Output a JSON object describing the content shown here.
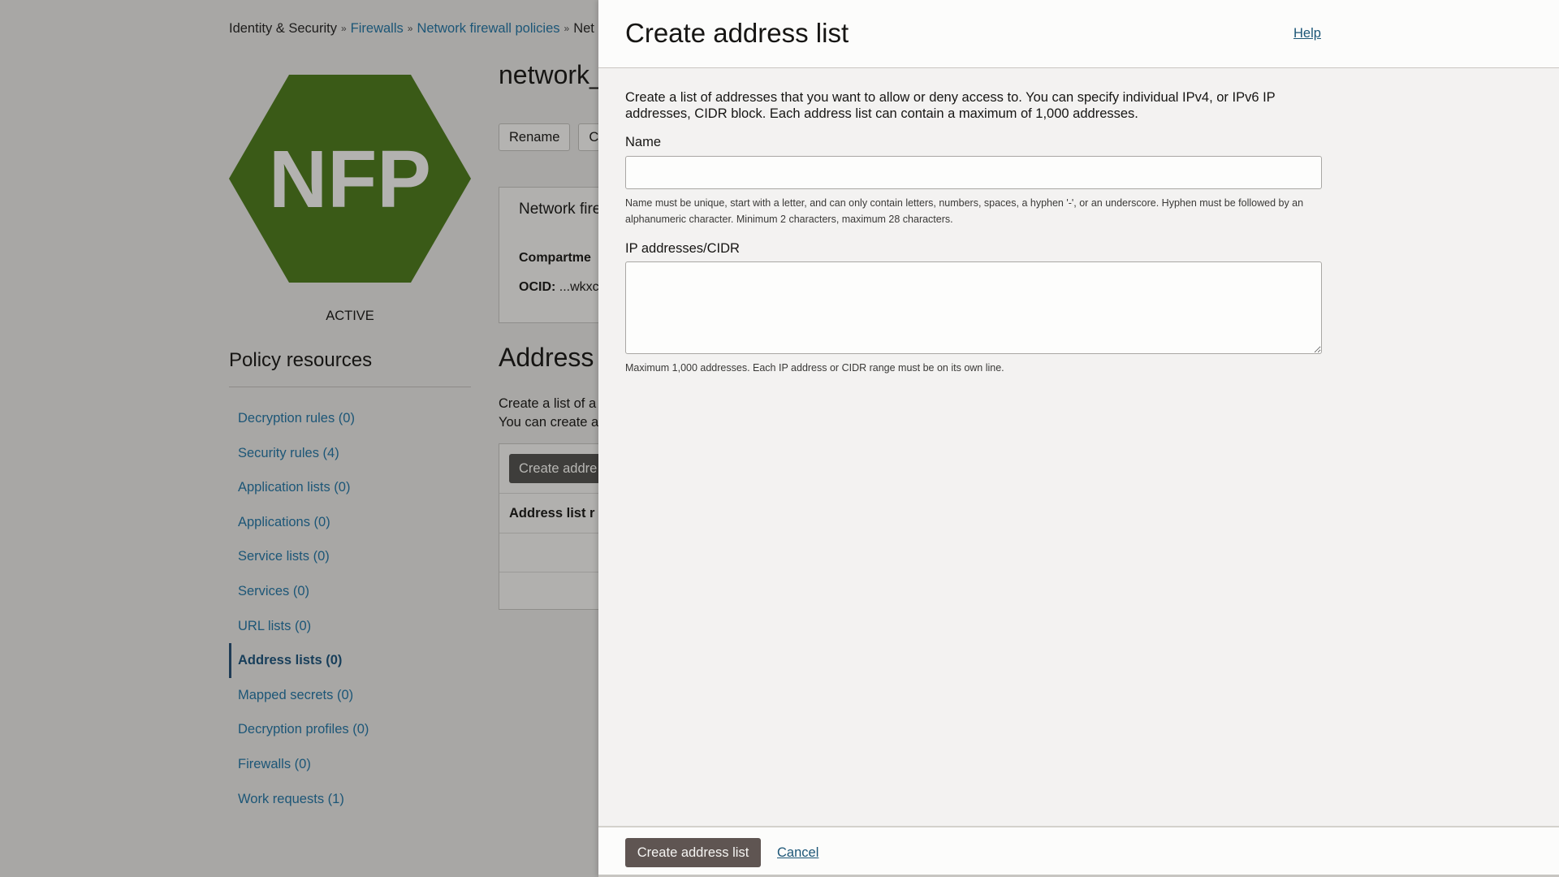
{
  "breadcrumb": [
    {
      "label": "Identity & Security",
      "link": false
    },
    {
      "label": "Firewalls",
      "link": true
    },
    {
      "label": "Network firewall policies",
      "link": true
    },
    {
      "label": "Net",
      "link": true
    }
  ],
  "resource": {
    "logo_text": "NFP",
    "logo_color": "#3a5a17",
    "status": "ACTIVE",
    "title": "network_",
    "buttons": [
      "Rename",
      "C"
    ],
    "info": {
      "title": "Network fire",
      "compartment_label": "Compartme",
      "ocid_label": "OCID:",
      "ocid_value": "...wkxc"
    }
  },
  "sidebar": {
    "title": "Policy resources",
    "items": [
      {
        "label": "Decryption rules (0)",
        "active": false
      },
      {
        "label": "Security rules (4)",
        "active": false
      },
      {
        "label": "Application lists (0)",
        "active": false
      },
      {
        "label": "Applications (0)",
        "active": false
      },
      {
        "label": "Service lists (0)",
        "active": false
      },
      {
        "label": "Services (0)",
        "active": false
      },
      {
        "label": "URL lists (0)",
        "active": false
      },
      {
        "label": "Address lists (0)",
        "active": true
      },
      {
        "label": "Mapped secrets (0)",
        "active": false
      },
      {
        "label": "Decryption profiles (0)",
        "active": false
      },
      {
        "label": "Firewalls (0)",
        "active": false
      },
      {
        "label": "Work requests (1)",
        "active": false
      }
    ]
  },
  "section": {
    "title": "Address",
    "desc_line1": "Create a list of a",
    "desc_line2": "You can create a",
    "create_button": "Create addre",
    "table_header": "Address list r"
  },
  "panel": {
    "title": "Create address list",
    "help_label": "Help",
    "description": "Create a list of addresses that you want to allow or deny access to. You can specify individual IPv4, or IPv6 IP addresses, CIDR block. Each address list can contain a maximum of 1,000 addresses.",
    "name_field": {
      "label": "Name",
      "value": "",
      "placeholder": "",
      "hint": "Name must be unique, start with a letter, and can only contain letters, numbers, spaces, a hyphen '-', or an underscore. Hyphen must be followed by an alphanumeric character. Minimum 2 characters, maximum 28 characters."
    },
    "ip_field": {
      "label": "IP addresses/CIDR",
      "value": "",
      "placeholder": "",
      "hint": "Maximum 1,000 addresses. Each IP address or CIDR range must be on its own line."
    },
    "footer": {
      "submit_label": "Create address list",
      "cancel_label": "Cancel"
    }
  },
  "colors": {
    "overlay": "#a8a7a5",
    "link": "#1c5677",
    "primary_button": "#5f5552",
    "panel_bg": "#f3f2f1"
  }
}
